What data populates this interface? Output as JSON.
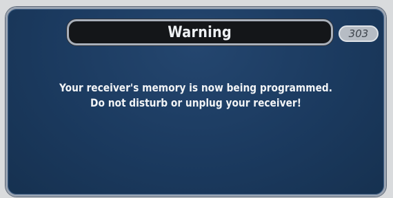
{
  "dialog": {
    "title": "Warning",
    "code": "303",
    "message_lines": [
      "Your receiver's memory is now being programmed.",
      "Do not disturb or unplug your receiver!"
    ]
  }
}
